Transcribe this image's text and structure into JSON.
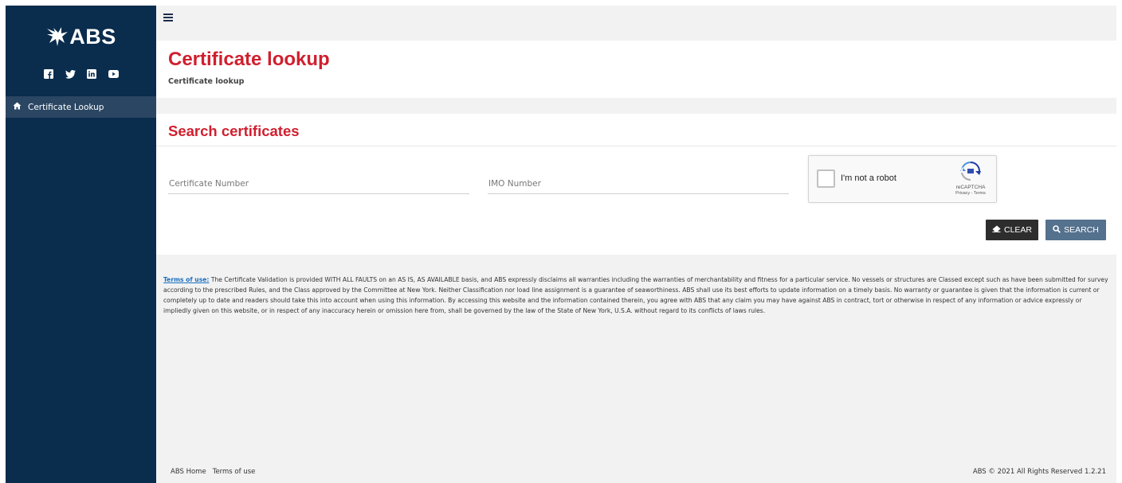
{
  "brand": {
    "logo_text": "ABS",
    "social": [
      "facebook-icon",
      "twitter-icon",
      "linkedin-icon",
      "youtube-icon"
    ]
  },
  "sidebar": {
    "items": [
      {
        "label": "Certificate Lookup",
        "icon": "home-icon"
      }
    ]
  },
  "header": {
    "title": "Certificate lookup",
    "breadcrumb": "Certificate lookup"
  },
  "search": {
    "section_title": "Search certificates",
    "certificate_placeholder": "Certificate Number",
    "imo_placeholder": "IMO Number",
    "captcha": {
      "label": "I'm not a robot",
      "brand": "reCAPTCHA",
      "links": "Privacy - Terms"
    },
    "clear_label": "CLEAR",
    "search_label": "SEARCH"
  },
  "terms": {
    "link_label": "Terms of use:",
    "text": "The Certificate Validation is provided WITH ALL FAULTS on an AS IS, AS AVAILABLE basis, and ABS expressly disclaims all warranties including the warranties of merchantability and fitness for a particular service. No vessels or structures are Classed except such as have been submitted for survey according to the prescribed Rules, and the Class approved by the Committee at New York. Neither Classification nor load line assignment is a guarantee of seaworthiness. ABS shall use its best efforts to update information on a timely basis. No warranty or guarantee is given that the information is current or completely up to date and readers should take this into account when using this information. By accessing this website and the information contained therein, you agree with ABS that any claim you may have against ABS in contract, tort or otherwise in respect of any information or advice expressly or impliedly given on this website, or in respect of any inaccuracy herein or omission here from, shall be governed by the law of the State of New York, U.S.A. without regard to its conflicts of laws rules."
  },
  "footer": {
    "home_link": "ABS Home",
    "terms_link": "Terms of use",
    "copyright": "ABS © 2021 All Rights Reserved 1.2.21"
  },
  "colors": {
    "sidebar_bg": "#0a2c4d",
    "nav_active": "#2a4663",
    "accent_red": "#d01f2e",
    "clear_btn": "#2d2d2d",
    "search_btn": "#54718e"
  }
}
